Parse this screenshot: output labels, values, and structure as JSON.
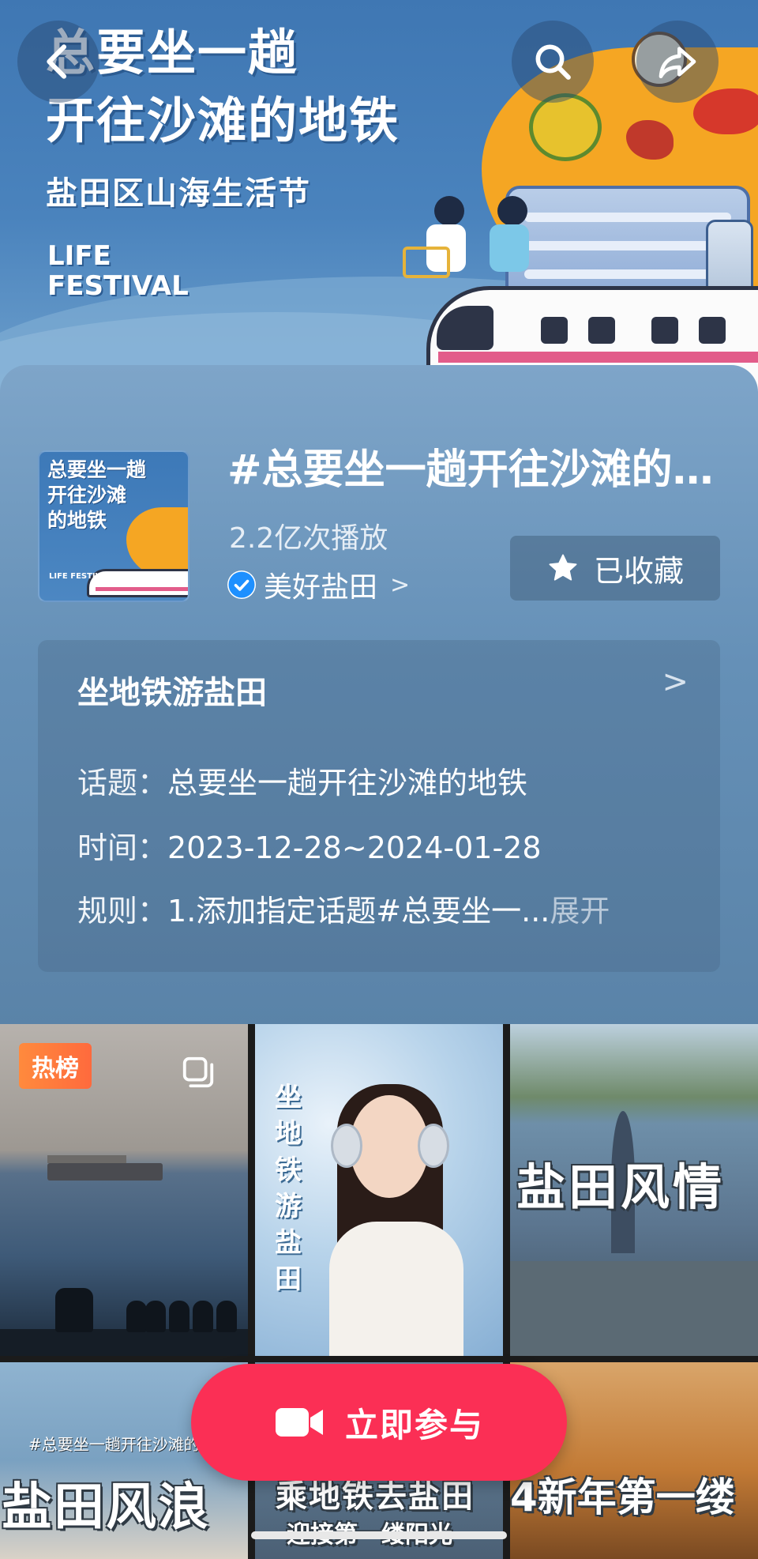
{
  "banner": {
    "title_line1": "总要坐一趟",
    "title_line2": "开往沙滩的地铁",
    "subtitle": "盐田区山海生活节",
    "life_line1": "LIFE",
    "life_line2": "FESTIVAL"
  },
  "nav": {
    "back_icon": "chevron-left-icon",
    "search_icon": "search-icon",
    "share_icon": "share-icon"
  },
  "topic": {
    "cover_line1": "总要坐一趟",
    "cover_line2": "开往沙滩",
    "cover_line3": "的地铁",
    "cover_life": "LIFE FESTIVAL",
    "title": "#总要坐一趟开往沙滩的地铁",
    "plays": "2.2亿次播放",
    "author": "美好盐田",
    "author_chevron": ">",
    "favorite_label": "已收藏"
  },
  "activity": {
    "title": "坐地铁游盐田",
    "chevron": ">",
    "topic_key": "话题：",
    "topic_value": "总要坐一趟开往沙滩的地铁",
    "time_key": "时间：",
    "time_value": "2023-12-28~2024-01-28",
    "rule_key": "规则：",
    "rule_value": "1.添加指定话题#总要坐一...",
    "expand_label": "展开"
  },
  "videos": [
    {
      "badge": "热榜"
    },
    {
      "caption": "坐地铁游盐田"
    },
    {
      "caption": "盐田风情"
    },
    {
      "caption_small": "#总要坐一趟开往沙滩的",
      "caption": "盐田风浪"
    },
    {
      "caption": "乘地铁去盐田",
      "caption2": "迎接第一缕阳光"
    },
    {
      "caption": "4新年第一缕"
    }
  ],
  "join": {
    "label": "立即参与",
    "icon": "video-camera-icon"
  },
  "colors": {
    "accent": "#fb2f55",
    "hot_badge": "#ff7a3d",
    "verified": "#1e90ff"
  }
}
